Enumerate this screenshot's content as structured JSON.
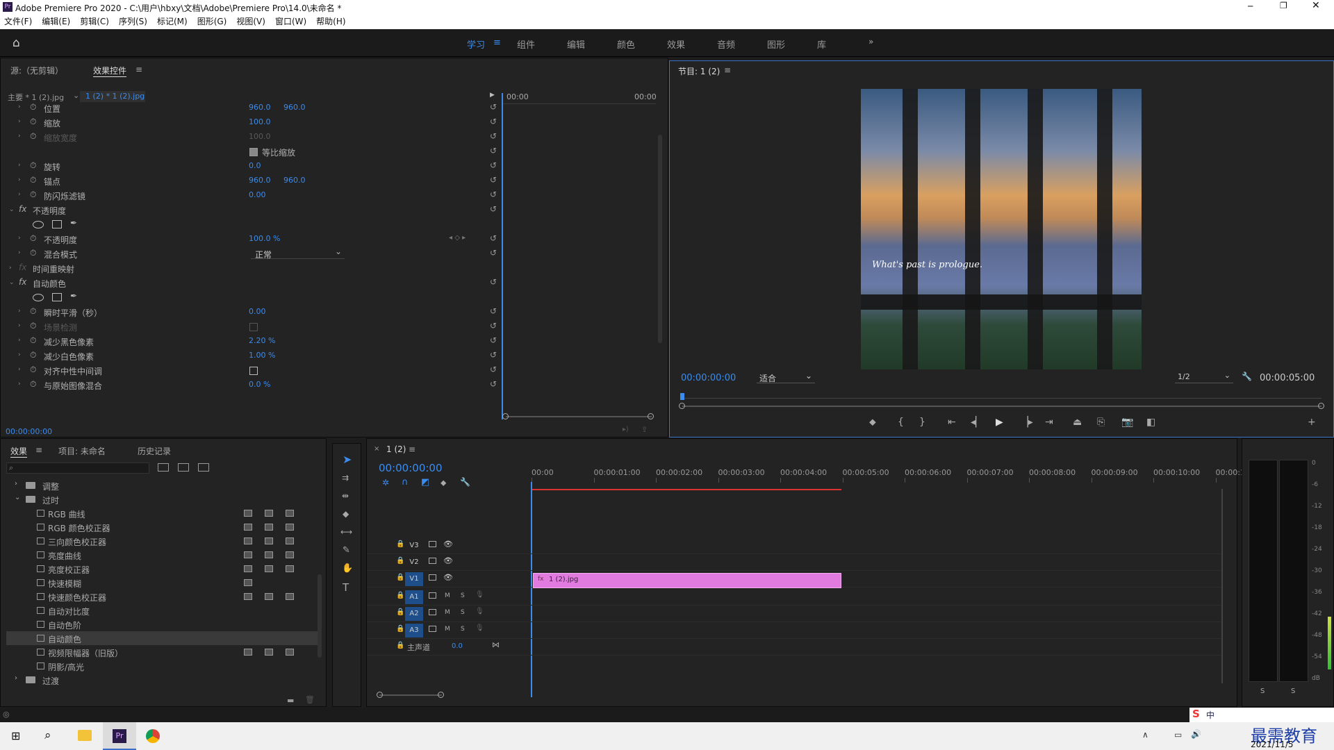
{
  "window": {
    "title": "Adobe Premiere Pro 2020 - C:\\用户\\hbxy\\文档\\Adobe\\Premiere Pro\\14.0\\未命名 *",
    "app_badge": "Pr"
  },
  "menu": [
    "文件(F)",
    "编辑(E)",
    "剪辑(C)",
    "序列(S)",
    "标记(M)",
    "图形(G)",
    "视图(V)",
    "窗口(W)",
    "帮助(H)"
  ],
  "workspaces": [
    "学习",
    "组件",
    "编辑",
    "颜色",
    "效果",
    "音频",
    "图形",
    "库"
  ],
  "active_workspace": "学习",
  "effect_controls": {
    "tabs": [
      "源:（无剪辑）",
      "效果控件"
    ],
    "master_label": "主要 * 1 (2).jpg",
    "clip_label": "1 (2) * 1 (2).jpg",
    "time_start": "00:00",
    "time_end": "00:00",
    "footer_time": "00:00:00:00",
    "rows": [
      {
        "label": "位置",
        "v1": "960.0",
        "v2": "960.0"
      },
      {
        "label": "缩放",
        "v1": "100.0"
      },
      {
        "label": "缩放宽度",
        "v1": "100.0",
        "disabled": true
      },
      {
        "label": "等比缩放",
        "checkbox": true
      },
      {
        "label": "旋转",
        "v1": "0.0"
      },
      {
        "label": "锚点",
        "v1": "960.0",
        "v2": "960.0"
      },
      {
        "label": "防闪烁滤镜",
        "v1": "0.00"
      },
      {
        "label": "不透明度",
        "fx": true
      },
      {
        "label": "",
        "masks": true
      },
      {
        "label": "不透明度",
        "v1": "100.0 %",
        "keyframe": true
      },
      {
        "label": "混合模式",
        "dropdown": "正常"
      },
      {
        "label": "时间重映射",
        "fx": true,
        "dimfx": true
      },
      {
        "label": "自动颜色",
        "fx": true
      },
      {
        "label": "",
        "masks": true
      },
      {
        "label": "瞬时平滑（秒）",
        "v1": "0.00"
      },
      {
        "label": "场景检测",
        "disabled": true,
        "checkbox2": true
      },
      {
        "label": "减少黑色像素",
        "v1": "2.20 %"
      },
      {
        "label": "减少白色像素",
        "v1": "1.00 %"
      },
      {
        "label": "对齐中性中间调",
        "checkbox2": true
      },
      {
        "label": "与原始图像混合",
        "v1": "0.0 %"
      }
    ]
  },
  "program": {
    "title": "节目: 1 (2)",
    "timecode": "00:00:00:00",
    "fit": "适合",
    "resolution": "1/2",
    "duration": "00:00:05:00",
    "caption": "What's past is prologue."
  },
  "effects_panel": {
    "tabs": [
      "效果",
      "项目: 未命名",
      "历史记录"
    ],
    "items": [
      {
        "label": "调整",
        "folder": true,
        "indent": 0
      },
      {
        "label": "过时",
        "folder": true,
        "indent": 0,
        "open": true
      },
      {
        "label": "RGB 曲线",
        "indent": 1,
        "badges": 3
      },
      {
        "label": "RGB 颜色校正器",
        "indent": 1,
        "badges": 3
      },
      {
        "label": "三向颜色校正器",
        "indent": 1,
        "badges": 3
      },
      {
        "label": "亮度曲线",
        "indent": 1,
        "badges": 3
      },
      {
        "label": "亮度校正器",
        "indent": 1,
        "badges": 3
      },
      {
        "label": "快速模糊",
        "indent": 1,
        "badges": 1
      },
      {
        "label": "快速颜色校正器",
        "indent": 1,
        "badges": 3
      },
      {
        "label": "自动对比度",
        "indent": 1,
        "badges": 0
      },
      {
        "label": "自动色阶",
        "indent": 1,
        "badges": 0
      },
      {
        "label": "自动颜色",
        "indent": 1,
        "badges": 0,
        "selected": true
      },
      {
        "label": "视频限幅器（旧版）",
        "indent": 1,
        "badges": 3
      },
      {
        "label": "阴影/高光",
        "indent": 1,
        "badges": 0
      },
      {
        "label": "过渡",
        "folder": true,
        "indent": 0
      }
    ]
  },
  "timeline": {
    "tab": "1 (2)",
    "timecode": "00:00:00:00",
    "ruler": [
      "00:00",
      "00:00:01:00",
      "00:00:02:00",
      "00:00:03:00",
      "00:00:04:00",
      "00:00:05:00",
      "00:00:06:00",
      "00:00:07:00",
      "00:00:08:00",
      "00:00:09:00",
      "00:00:10:00",
      "00:00:1"
    ],
    "tracks": [
      "V3",
      "V2",
      "V1",
      "A1",
      "A2",
      "A3"
    ],
    "master_label": "主声道",
    "master_value": "0.0",
    "clip_label": "1 (2).jpg",
    "clip_color": "#e17be0"
  },
  "meter": {
    "ticks": [
      "0",
      "-6",
      "-12",
      "-18",
      "-24",
      "-30",
      "-36",
      "-42",
      "-48",
      "-54",
      "dB"
    ],
    "solo": [
      "S",
      "S"
    ]
  },
  "taskbar": {
    "date": "2021/11/5",
    "ime": "中",
    "watermark": "最需教育"
  }
}
